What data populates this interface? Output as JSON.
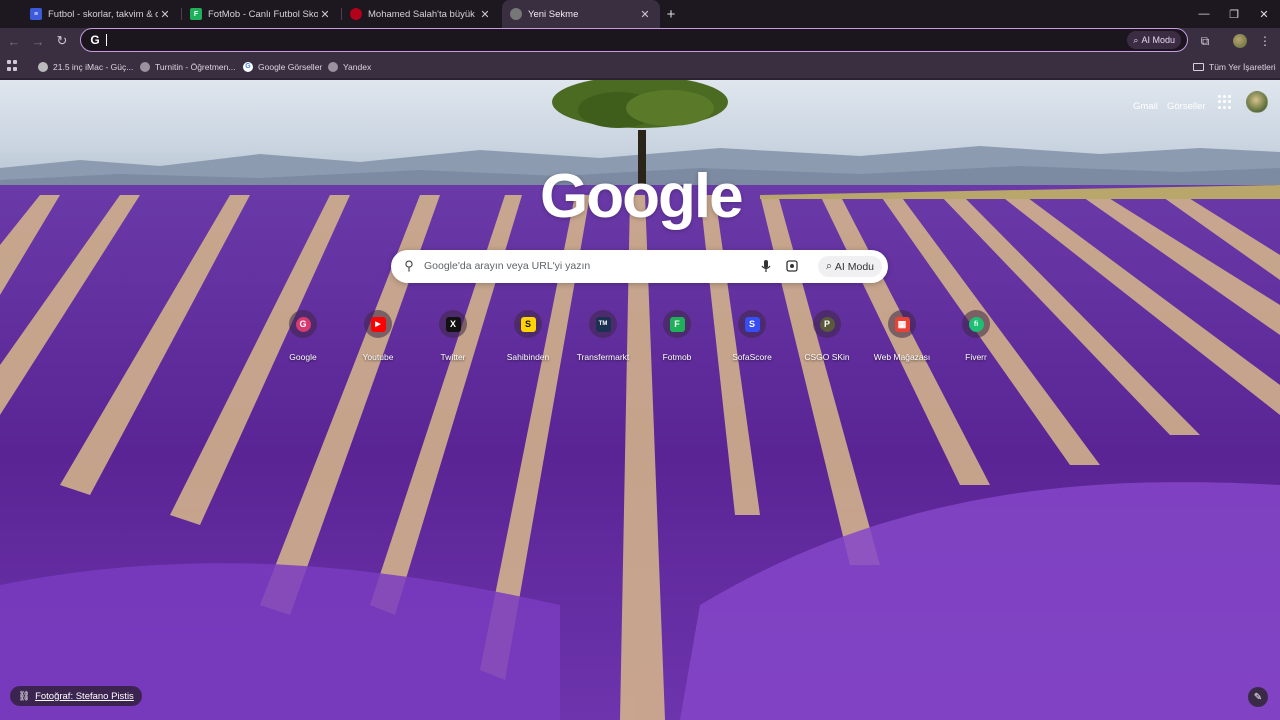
{
  "tabs": [
    {
      "title": "Futbol - skorlar, takvim & oranl",
      "color": "#3b5bdb",
      "glyph": "≡",
      "active": false
    },
    {
      "title": "FotMob - Canlı Futbol Skorları",
      "color": "#1fb05a",
      "glyph": "F",
      "active": false
    },
    {
      "title": "Mohamed Salah'ta büyük sürpriz",
      "color": "#b3001b",
      "glyph": "",
      "active": false
    },
    {
      "title": "Yeni Sekme",
      "color": "#888888",
      "glyph": "",
      "active": true
    }
  ],
  "toolbar": {
    "omnibox_prefix": "G",
    "ai_mode": "AI Modu"
  },
  "bookmarks": [
    {
      "label": "21.5 inç iMac - Güç...",
      "icon": "apple-icon"
    },
    {
      "label": "Turnitin - Öğretmen...",
      "icon": "globe-icon"
    },
    {
      "label": "Google Görseller",
      "icon": "google-icon"
    },
    {
      "label": "Yandex",
      "icon": "globe-icon"
    }
  ],
  "bookmarks_all": "Tüm Yer İşaretleri",
  "ntp": {
    "gmail": "Gmail",
    "images": "Görseller",
    "logo": "Google",
    "search_placeholder": "Google'da arayın veya URL'yi yazın",
    "ai_mode": "AI Modu",
    "photo_credit": "Fotoğraf: Stefano Pistis"
  },
  "shortcuts": [
    {
      "label": "Google",
      "glyph": "G",
      "color": "#d63a6e"
    },
    {
      "label": "Youtube",
      "glyph": "▶",
      "color": "#ff0000"
    },
    {
      "label": "Twitter",
      "glyph": "X",
      "color": "#111111"
    },
    {
      "label": "Sahibinden",
      "glyph": "S",
      "color": "#ffd400"
    },
    {
      "label": "Transfermarkt",
      "glyph": "TM",
      "color": "#1a3151"
    },
    {
      "label": "Fotmob",
      "glyph": "F",
      "color": "#1fb05a"
    },
    {
      "label": "SofaScore",
      "glyph": "S",
      "color": "#374df5"
    },
    {
      "label": "CSGO SKin",
      "glyph": "P",
      "color": "#5a5a3a"
    },
    {
      "label": "Web Mağazası",
      "glyph": "▦",
      "color": "#e94235"
    },
    {
      "label": "Fiverr",
      "glyph": "fi",
      "color": "#1dbf73"
    }
  ],
  "colors": {
    "omnibox_border": "#c89be0",
    "chrome_bg": "#3a2f40",
    "lavender": "#5a2f98"
  }
}
